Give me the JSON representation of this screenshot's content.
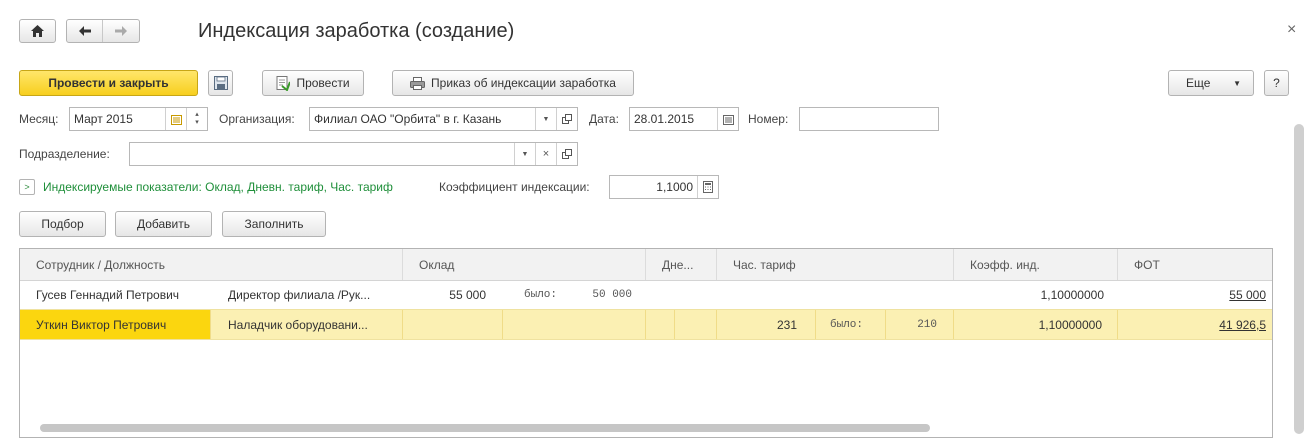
{
  "window": {
    "title": "Индексация заработка (создание)",
    "close_glyph": "×"
  },
  "nav": {
    "home_icon": "home-icon",
    "back_icon": "arrow-left-icon",
    "forward_icon": "arrow-right-icon"
  },
  "toolbar": {
    "post_close_label": "Провести и закрыть",
    "save_icon": "save-icon",
    "post_label": "Провести",
    "print_label": "Приказ об индексации заработка",
    "more_label": "Еще",
    "help_label": "?"
  },
  "header": {
    "month_label": "Месяц:",
    "month_value": "Март 2015",
    "org_label": "Организация:",
    "org_value": "Филиал ОАО \"Орбита\" в г. Казань",
    "date_label": "Дата:",
    "date_value": "28.01.2015",
    "number_label": "Номер:",
    "number_value": "",
    "dept_label": "Подразделение:",
    "dept_value": "",
    "indexed_link": "Индексируемые показатели: Оклад, Дневн. тариф, Час. тариф",
    "coef_label": "Коэффициент индексации:",
    "coef_value": "1,1000"
  },
  "table_buttons": {
    "pick_label": "Подбор",
    "add_label": "Добавить",
    "fill_label": "Заполнить"
  },
  "table": {
    "headers": {
      "employee": "Сотрудник / Должность",
      "salary": "Оклад",
      "daily": "Дне...",
      "hourly": "Час. тариф",
      "coef": "Коэфф. инд.",
      "fot": "ФОТ"
    },
    "rows": [
      {
        "name": "Гусев Геннадий Петрович",
        "position": "Директор филиала /Рук...",
        "salary": "55 000",
        "salary_was_label": "было:",
        "salary_was": "50 000",
        "hourly": "",
        "hourly_was_label": "",
        "hourly_was": "",
        "coef": "1,10000000",
        "fot": "55 000"
      },
      {
        "name": "Уткин Виктор Петрович",
        "position": "Наладчик оборудовани...",
        "salary": "",
        "salary_was_label": "",
        "salary_was": "",
        "hourly": "231",
        "hourly_was_label": "было:",
        "hourly_was": "210",
        "coef": "1,10000000",
        "fot": "41 926,5"
      }
    ]
  },
  "colors": {
    "primary_button": "#f7cf1e",
    "selected_row": "#fbf0b3",
    "selected_cell": "#fbd60f",
    "link_green": "#1f8f3a"
  }
}
